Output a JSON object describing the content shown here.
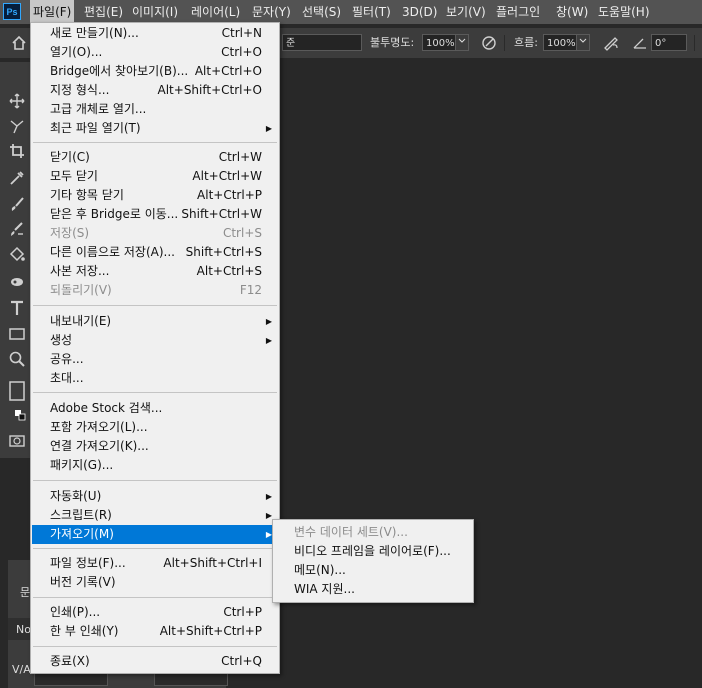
{
  "app": {
    "logo": "Ps"
  },
  "menubar": [
    {
      "label": "파일(F)",
      "active": true
    },
    {
      "label": "편집(E)"
    },
    {
      "label": "이미지(I)"
    },
    {
      "label": "레이어(L)"
    },
    {
      "label": "문자(Y)"
    },
    {
      "label": "선택(S)"
    },
    {
      "label": "필터(T)"
    },
    {
      "label": "3D(D)"
    },
    {
      "label": "보기(V)"
    },
    {
      "label": "플러그인"
    },
    {
      "label": "창(W)"
    },
    {
      "label": "도움말(H)"
    }
  ],
  "options": {
    "mode_value": "준",
    "opacity_label": "불투명도:",
    "opacity_value": "100%",
    "flow_label": "흐름:",
    "flow_value": "100%",
    "angle_value": "0°"
  },
  "file_menu": [
    {
      "label": "새로 만들기(N)...",
      "shortcut": "Ctrl+N"
    },
    {
      "label": "열기(O)...",
      "shortcut": "Ctrl+O"
    },
    {
      "label": "Bridge에서 찾아보기(B)...",
      "shortcut": "Alt+Ctrl+O"
    },
    {
      "label": "지정 형식...",
      "shortcut": "Alt+Shift+Ctrl+O"
    },
    {
      "label": "고급 개체로 열기...",
      "shortcut": ""
    },
    {
      "label": "최근 파일 열기(T)",
      "shortcut": "",
      "submenu": true
    },
    {
      "label": "닫기(C)",
      "shortcut": "Ctrl+W"
    },
    {
      "label": "모두 닫기",
      "shortcut": "Alt+Ctrl+W"
    },
    {
      "label": "기타 항목 닫기",
      "shortcut": "Alt+Ctrl+P"
    },
    {
      "label": "닫은 후 Bridge로 이동...",
      "shortcut": "Shift+Ctrl+W"
    },
    {
      "label": "저장(S)",
      "shortcut": "Ctrl+S",
      "disabled": true
    },
    {
      "label": "다른 이름으로 저장(A)...",
      "shortcut": "Shift+Ctrl+S"
    },
    {
      "label": "사본 저장...",
      "shortcut": "Alt+Ctrl+S"
    },
    {
      "label": "되돌리기(V)",
      "shortcut": "F12",
      "disabled": true
    },
    {
      "label": "내보내기(E)",
      "shortcut": "",
      "submenu": true
    },
    {
      "label": "생성",
      "shortcut": "",
      "submenu": true
    },
    {
      "label": "공유...",
      "shortcut": ""
    },
    {
      "label": "초대...",
      "shortcut": ""
    },
    {
      "label": "Adobe Stock 검색...",
      "shortcut": ""
    },
    {
      "label": "포함 가져오기(L)...",
      "shortcut": ""
    },
    {
      "label": "연결 가져오기(K)...",
      "shortcut": ""
    },
    {
      "label": "패키지(G)...",
      "shortcut": ""
    },
    {
      "label": "자동화(U)",
      "shortcut": "",
      "submenu": true
    },
    {
      "label": "스크립트(R)",
      "shortcut": "",
      "submenu": true
    },
    {
      "label": "가져오기(M)",
      "shortcut": "",
      "submenu": true,
      "highlighted": true
    },
    {
      "label": "파일 정보(F)...",
      "shortcut": "Alt+Shift+Ctrl+I"
    },
    {
      "label": "버전 기록(V)",
      "shortcut": ""
    },
    {
      "label": "인쇄(P)...",
      "shortcut": "Ctrl+P"
    },
    {
      "label": "한 부 인쇄(Y)",
      "shortcut": "Alt+Shift+Ctrl+P"
    },
    {
      "label": "종료(X)",
      "shortcut": "Ctrl+Q"
    }
  ],
  "import_submenu": [
    {
      "label": "변수 데이터 세트(V)...",
      "disabled": true
    },
    {
      "label": "비디오 프레임을 레이어로(F)..."
    },
    {
      "label": "메모(N)..."
    },
    {
      "label": "WIA 지원..."
    }
  ],
  "panel": {
    "tab_label": "문",
    "font_label": "No",
    "va_label": "V/A"
  }
}
